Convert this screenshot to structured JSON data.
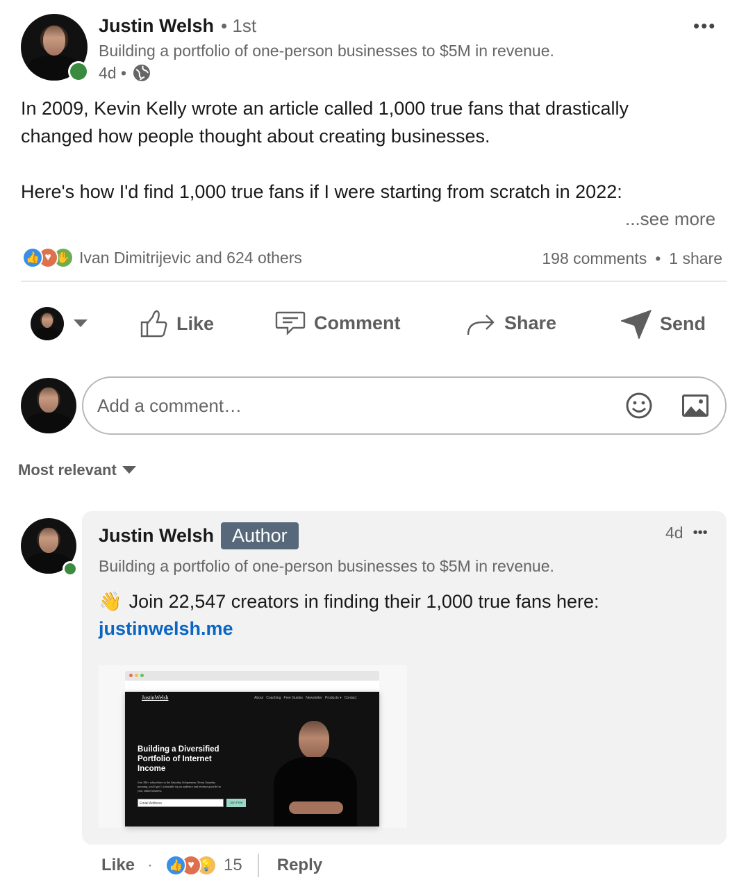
{
  "post": {
    "author_name": "Justin Welsh",
    "degree": "• 1st",
    "headline": "Building a portfolio of one-person businesses to $5M in revenue.",
    "age": "4d •",
    "overflow": "•••",
    "paragraph1_line1": "In 2009, Kevin Kelly wrote an article called 1,000 true fans that drastically",
    "paragraph1_line2": "changed how people thought about creating businesses.",
    "paragraph2": "Here's how I'd find 1,000 true fans if I were starting from scratch in 2022:",
    "see_more": "...see more",
    "reactions_text": "Ivan Dimitrijevic and 624 others",
    "comments_count": "198 comments",
    "shares_count": "1 share",
    "separator": "•"
  },
  "actions": {
    "like": "Like",
    "comment": "Comment",
    "share": "Share",
    "send": "Send"
  },
  "composer": {
    "placeholder": "Add a comment…"
  },
  "sort": {
    "label": "Most relevant"
  },
  "comment": {
    "author_name": "Justin Welsh",
    "badge": "Author",
    "headline": "Building a portfolio of one-person businesses to $5M in revenue.",
    "age": "4d",
    "overflow": "•••",
    "emoji": "👋",
    "text": "Join 22,547 creators in finding their 1,000 true fans here:",
    "link": "justinwelsh.me",
    "preview": {
      "brand": "JustinWelsh",
      "nav": "About   Coaching   Free Guides   Newsletter   Products ▾   Contact",
      "hero_line1": "Building a Diversified",
      "hero_line2": "Portfolio of Internet",
      "hero_line3": "Income",
      "sub_line1": "Join 18k+ subscribers to the Saturday Solopreneur. Every Saturday",
      "sub_line2": "morning, you'll get 1 actionable tip on audience and revenue growth for",
      "sub_line3": "your online business.",
      "email_placeholder": "Email Address",
      "cta": "Join Free"
    },
    "like": "Like",
    "dot": "·",
    "reaction_count": "15",
    "reply": "Reply"
  },
  "colors": {
    "link": "#0a66c2",
    "badge": "#56687a",
    "online": "#3a8a3f"
  },
  "icons": [
    "overflow-icon",
    "globe-icon",
    "like-reaction-icon",
    "love-reaction-icon",
    "celebrate-reaction-icon",
    "insightful-reaction-icon",
    "caret-down-icon",
    "thumbs-up-icon",
    "comment-icon",
    "share-icon",
    "send-icon",
    "emoji-icon",
    "image-icon"
  ]
}
